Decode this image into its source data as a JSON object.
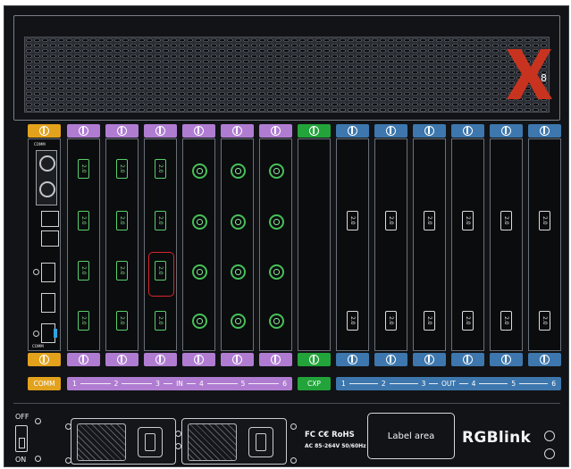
{
  "logo_mark": "X",
  "logo_sub": "8",
  "comm_label": "COMM",
  "comm_bottom_label": "COMM",
  "port_version": "2.0",
  "input_strip": {
    "numbers": [
      "1",
      "2",
      "3",
      "4",
      "5",
      "6"
    ],
    "label": "IN"
  },
  "cxp_label": "CXP",
  "output_strip": {
    "numbers": [
      "1",
      "2",
      "3",
      "4",
      "5",
      "6"
    ],
    "label": "OUT"
  },
  "power": {
    "off_label": "OFF",
    "on_label": "ON"
  },
  "certs": {
    "marks": "FC C€ RoHS",
    "voltage": "AC 85-264V 50/60Hz"
  },
  "label_area": "Label area",
  "brand": "RGBlink",
  "colors": {
    "comm_tab": "#e2a21c",
    "input_tab": "#b07cd2",
    "cxp_tab": "#22a43a",
    "output_tab": "#3d77ad",
    "highlight": "#d9262a"
  }
}
